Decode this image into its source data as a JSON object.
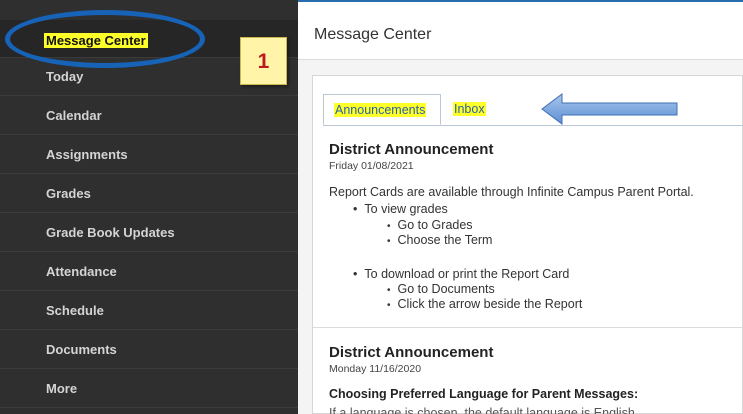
{
  "sidebar": {
    "items": [
      {
        "label": "Message Center"
      },
      {
        "label": "Today"
      },
      {
        "label": "Calendar"
      },
      {
        "label": "Assignments"
      },
      {
        "label": "Grades"
      },
      {
        "label": "Grade Book Updates"
      },
      {
        "label": "Attendance"
      },
      {
        "label": "Schedule"
      },
      {
        "label": "Documents"
      },
      {
        "label": "More"
      }
    ]
  },
  "annotation": {
    "step_number": "1",
    "ring_color": "#1763b7",
    "highlight_color": "#ffff29"
  },
  "main": {
    "title": "Message Center",
    "tabs": [
      {
        "label": "Announcements"
      },
      {
        "label": "Inbox"
      }
    ],
    "announcements": [
      {
        "title": "District Announcement",
        "date": "Friday 01/08/2021",
        "intro": "Report Cards are available through Infinite Campus Parent Portal.",
        "bullets": [
          {
            "text": "To view grades",
            "sub": [
              "Go to Grades",
              "Choose the Term"
            ]
          },
          {
            "text": "To download or print the Report Card",
            "sub": [
              "Go to Documents",
              "Click the arrow beside the Report"
            ]
          }
        ]
      },
      {
        "title": "District Announcement",
        "date": "Monday 11/16/2020",
        "subheading": "Choosing Preferred Language for Parent Messages:",
        "cut_text": "If a language is chosen, the default language is English..."
      }
    ]
  }
}
